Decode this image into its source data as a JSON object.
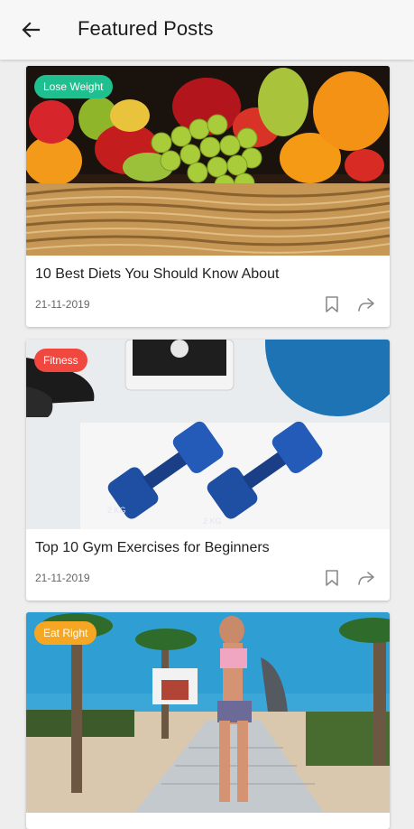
{
  "appbar": {
    "title": "Featured Posts",
    "back_icon": "arrow-left-icon"
  },
  "posts": [
    {
      "category": "Lose Weight",
      "category_color": "#1fbf8f",
      "title": "10 Best Diets You Should Know About",
      "date": "21-11-2019",
      "image": "fruit-basket"
    },
    {
      "category": "Fitness",
      "category_color": "#f0473f",
      "title": "Top 10 Gym Exercises for Beginners",
      "date": "21-11-2019",
      "image": "dumbbells",
      "dumbbell_weight": "2 KG"
    },
    {
      "category": "Eat Right",
      "category_color": "#f5a623",
      "title": "",
      "date": "",
      "image": "beach-runner"
    }
  ]
}
